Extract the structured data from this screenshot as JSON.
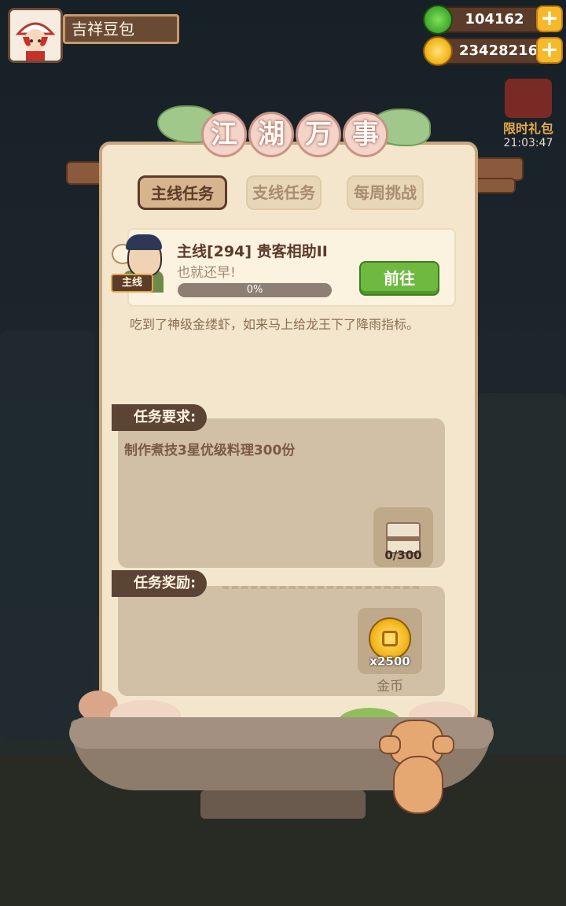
{
  "profile": {
    "name": "吉祥豆包",
    "avatar_icon": "chef-avatar-icon"
  },
  "currencies": [
    {
      "name": "jade",
      "value": "104162",
      "icon": "jade-icon",
      "color": "#3fa72b"
    },
    {
      "name": "gold",
      "value": "23428216",
      "icon": "gold-coin-icon",
      "color": "#f3b81f"
    }
  ],
  "plus_label": "+",
  "gift": {
    "label": "限时礼包",
    "timer": "21:03:47"
  },
  "panel": {
    "title_chars": [
      "江",
      "湖",
      "万",
      "事"
    ],
    "tabs": [
      {
        "label": "主线任务",
        "active": true
      },
      {
        "label": "支线任务",
        "active": false
      },
      {
        "label": "每周挑战",
        "active": false
      }
    ],
    "task": {
      "badge": "主线",
      "title": "主线[294] 贵客相助II",
      "subtitle": "也就还早!",
      "progress": 0,
      "progress_text": "0%",
      "go_button": "前往"
    },
    "description": "吃到了神级金缕虾，如来马上给龙王下了降雨指标。",
    "requirement": {
      "label": "任务要求:",
      "text": "制作煮技3星优级料理300份",
      "item_count": "0/300"
    },
    "reward": {
      "label": "任务奖励:",
      "amount": "x2500",
      "name": "金币"
    }
  },
  "colors": {
    "panel_bg": "#f3e6cc",
    "accent_brown": "#5b3b2a",
    "go_green": "#6fb940",
    "progress_fill": "#7cc34a"
  }
}
